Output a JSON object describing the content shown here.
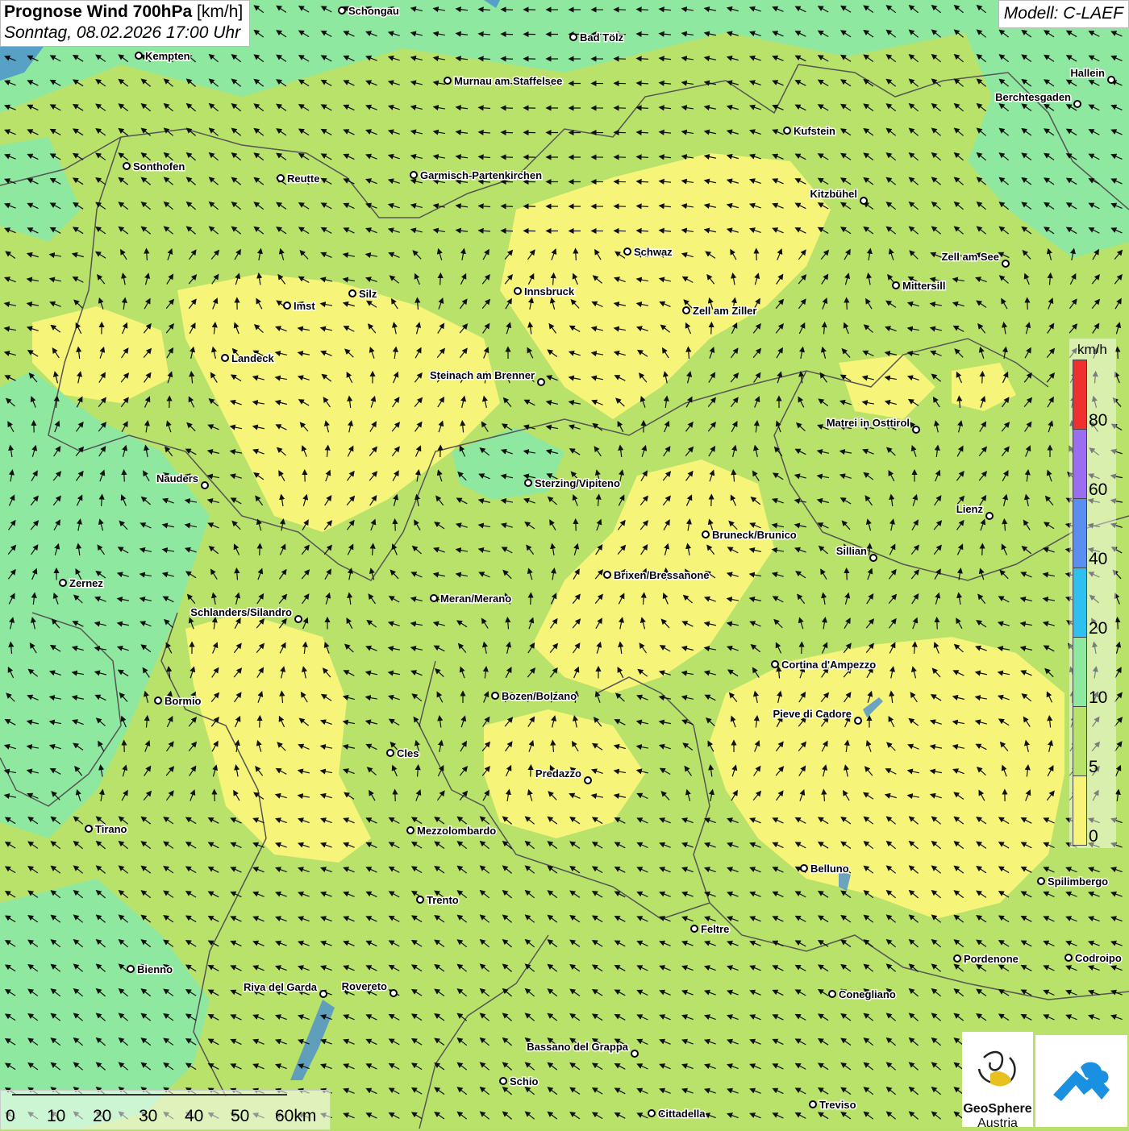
{
  "title": {
    "main": "Prognose Wind 700hPa",
    "unit": "[km/h]",
    "datetime": "Sonntag, 08.02.2026 17:00 Uhr"
  },
  "model": "Modell: C-LAEF",
  "colors": {
    "wind_0_5": "#f6f57a",
    "wind_5_10": "#b9e26a",
    "wind_10_20": "#8ee8a0",
    "wind_20_40": "#2fc0f0",
    "wind_40_60": "#5a8ef0",
    "wind_60_80": "#9a6ef0",
    "wind_80_plus": "#f03030",
    "border": "#555555",
    "lake": "#4a8fd0"
  },
  "legend": {
    "unit": "km/h",
    "bins": [
      {
        "from": 0,
        "to": 5,
        "color": "#f6f57a"
      },
      {
        "from": 5,
        "to": 10,
        "color": "#b9e26a"
      },
      {
        "from": 10,
        "to": 20,
        "color": "#8ee8a0"
      },
      {
        "from": 20,
        "to": 40,
        "color": "#2fc0f0"
      },
      {
        "from": 40,
        "to": 60,
        "color": "#5a8ef0"
      },
      {
        "from": 60,
        "to": 80,
        "color": "#9a6ef0"
      },
      {
        "from": 80,
        "to": null,
        "color": "#f03030"
      }
    ],
    "labels": [
      "0",
      "5",
      "10",
      "20",
      "40",
      "60",
      "80"
    ]
  },
  "scale_bar": {
    "labels": [
      "0",
      "10",
      "20",
      "30",
      "40",
      "50",
      "60km"
    ]
  },
  "logos": {
    "geosphere_line1": "GeoSphere",
    "geosphere_line2": "Austria"
  },
  "cities": [
    {
      "name": "Schongau"
    },
    {
      "name": "Bad Tölz"
    },
    {
      "name": "Kempten"
    },
    {
      "name": "Murnau am Staffelsee"
    },
    {
      "name": "Hallein"
    },
    {
      "name": "Berchtesgaden"
    },
    {
      "name": "Kufstein"
    },
    {
      "name": "Sonthofen"
    },
    {
      "name": "Reutte"
    },
    {
      "name": "Garmisch-Partenkirchen"
    },
    {
      "name": "Kitzbühel"
    },
    {
      "name": "Schwaz"
    },
    {
      "name": "Zell am See"
    },
    {
      "name": "Mittersill"
    },
    {
      "name": "Silz"
    },
    {
      "name": "Innsbruck"
    },
    {
      "name": "Imst"
    },
    {
      "name": "Zell am Ziller"
    },
    {
      "name": "Landeck"
    },
    {
      "name": "Steinach am Brenner"
    },
    {
      "name": "Matrei in Osttirol"
    },
    {
      "name": "Nauders"
    },
    {
      "name": "Sterzing/Vipiteno"
    },
    {
      "name": "Lienz"
    },
    {
      "name": "Bruneck/Brunico"
    },
    {
      "name": "Sillian"
    },
    {
      "name": "Brixen/Bressanone"
    },
    {
      "name": "Zernez"
    },
    {
      "name": "Meran/Merano"
    },
    {
      "name": "Schlanders/Silandro"
    },
    {
      "name": "Cortina d'Ampezzo"
    },
    {
      "name": "Bozen/Bolzano"
    },
    {
      "name": "Bormio"
    },
    {
      "name": "Pieve di Cadore"
    },
    {
      "name": "Cles"
    },
    {
      "name": "Predazzo"
    },
    {
      "name": "Tirano"
    },
    {
      "name": "Mezzolombardo"
    },
    {
      "name": "Belluno"
    },
    {
      "name": "Spilimbergo"
    },
    {
      "name": "Trento"
    },
    {
      "name": "Feltre"
    },
    {
      "name": "Pordenone"
    },
    {
      "name": "Codroipo"
    },
    {
      "name": "Bienno"
    },
    {
      "name": "Riva del Garda"
    },
    {
      "name": "Rovereto"
    },
    {
      "name": "Conegliano"
    },
    {
      "name": "Bassano del Grappa"
    },
    {
      "name": "Schio"
    },
    {
      "name": "Treviso"
    },
    {
      "name": "Cittadella"
    }
  ]
}
